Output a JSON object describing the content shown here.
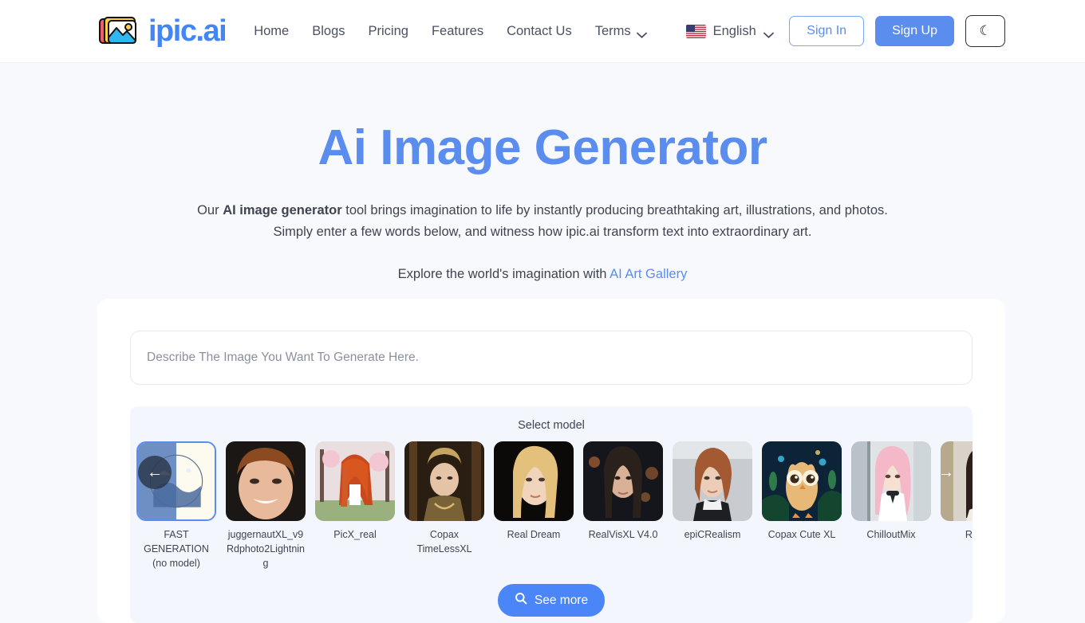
{
  "header": {
    "logo_text": "ipic.ai",
    "logo_icon": "photo-stack-icon",
    "nav": [
      {
        "label": "Home"
      },
      {
        "label": "Blogs"
      },
      {
        "label": "Pricing"
      },
      {
        "label": "Features"
      },
      {
        "label": "Contact Us"
      }
    ],
    "terms": {
      "label": "Terms",
      "icon": "chevron-down-icon"
    },
    "language": {
      "label": "English",
      "flag": "us-flag-icon",
      "icon": "chevron-down-icon"
    },
    "sign_in": "Sign In",
    "sign_up": "Sign Up",
    "theme_toggle": {
      "icon": "moon-icon",
      "glyph": "☾"
    },
    "accent_color": "#5b8def"
  },
  "hero": {
    "title": "Ai Image Generator",
    "desc_line1_pre": "Our ",
    "desc_line1_bold": "AI image generator",
    "desc_line1_post": " tool brings imagination to life by instantly producing breathtaking art, illustrations, and photos.",
    "desc_line2": "Simply enter a few words below, and witness how ipic.ai transform text into extraordinary art.",
    "explore_text": "Explore the world's imagination with ",
    "explore_link": "AI Art Gallery"
  },
  "generator": {
    "prompt_placeholder": "Describe The Image You Want To Generate Here.",
    "prompt_value": "",
    "select_model_label": "Select model",
    "prev_arrow": "←",
    "next_arrow": "→",
    "see_more_label": "See more",
    "see_more_icon": "search-icon",
    "models": [
      {
        "label": "FAST GENERATION (no model)",
        "selected": true
      },
      {
        "label": "juggernautXL_v9Rdphoto2Lightning",
        "selected": false
      },
      {
        "label": "PicX_real",
        "selected": false
      },
      {
        "label": "Copax TimeLessXL",
        "selected": false
      },
      {
        "label": "Real Dream",
        "selected": false
      },
      {
        "label": "RealVisXL V4.0",
        "selected": false
      },
      {
        "label": "epiCRealism",
        "selected": false
      },
      {
        "label": "Copax Cute XL",
        "selected": false
      },
      {
        "label": "ChilloutMix",
        "selected": false
      },
      {
        "label": "Realist",
        "selected": false
      }
    ]
  }
}
